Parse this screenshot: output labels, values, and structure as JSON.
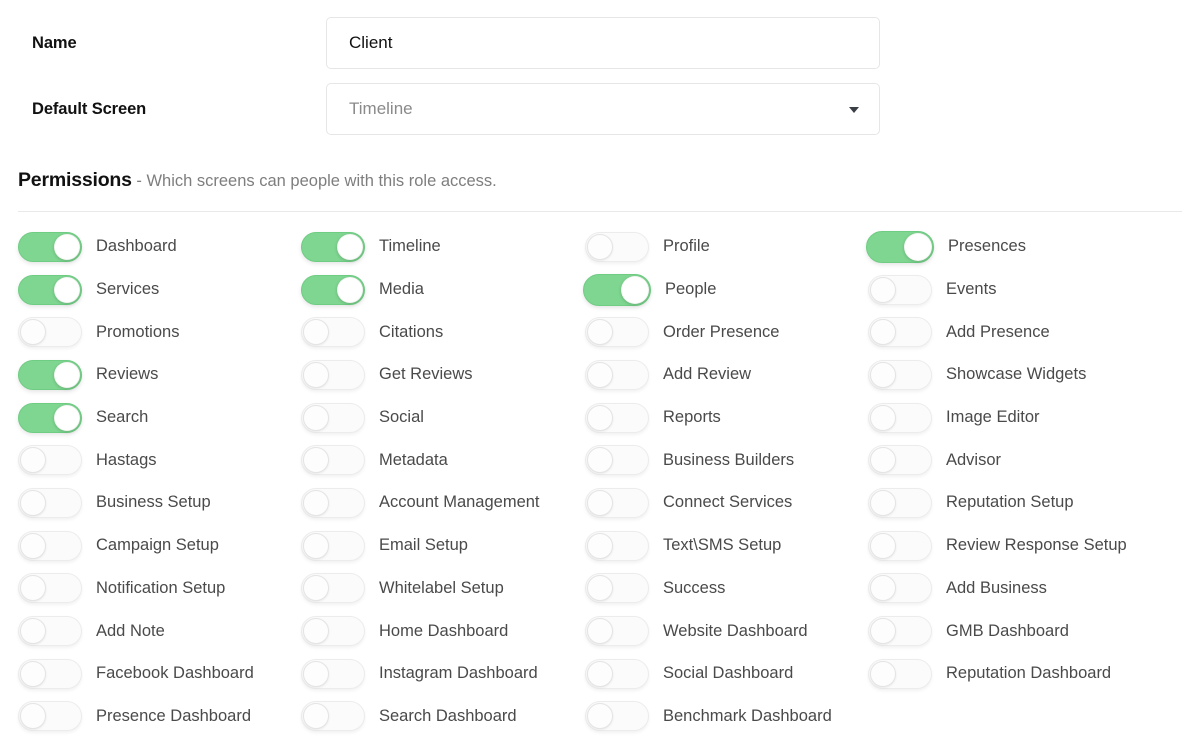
{
  "form": {
    "name": {
      "label": "Name",
      "value": "Client",
      "placeholder": "Name"
    },
    "default_screen": {
      "label": "Default Screen",
      "value": "Timeline",
      "caret_icon": "chevron-down-icon"
    }
  },
  "permissions": {
    "heading": "Permissions",
    "subheading": " - Which screens can people with this role access.",
    "accent_on_color": "#7ed690",
    "off_track_color": "#fbfbfb",
    "columns": 4,
    "items": [
      {
        "label": "Dashboard",
        "on": true,
        "hovered": false
      },
      {
        "label": "Timeline",
        "on": true,
        "hovered": false
      },
      {
        "label": "Profile",
        "on": false,
        "hovered": false
      },
      {
        "label": "Presences",
        "on": true,
        "hovered": true
      },
      {
        "label": "Services",
        "on": true,
        "hovered": false
      },
      {
        "label": "Media",
        "on": true,
        "hovered": false
      },
      {
        "label": "People",
        "on": true,
        "hovered": true
      },
      {
        "label": "Events",
        "on": false,
        "hovered": false
      },
      {
        "label": "Promotions",
        "on": false,
        "hovered": false
      },
      {
        "label": "Citations",
        "on": false,
        "hovered": false
      },
      {
        "label": "Order Presence",
        "on": false,
        "hovered": false
      },
      {
        "label": "Add Presence",
        "on": false,
        "hovered": false
      },
      {
        "label": "Reviews",
        "on": true,
        "hovered": false
      },
      {
        "label": "Get Reviews",
        "on": false,
        "hovered": false
      },
      {
        "label": "Add Review",
        "on": false,
        "hovered": false
      },
      {
        "label": "Showcase Widgets",
        "on": false,
        "hovered": false
      },
      {
        "label": "Search",
        "on": true,
        "hovered": false
      },
      {
        "label": "Social",
        "on": false,
        "hovered": false
      },
      {
        "label": "Reports",
        "on": false,
        "hovered": false
      },
      {
        "label": "Image Editor",
        "on": false,
        "hovered": false
      },
      {
        "label": "Hastags",
        "on": false,
        "hovered": false
      },
      {
        "label": "Metadata",
        "on": false,
        "hovered": false
      },
      {
        "label": "Business Builders",
        "on": false,
        "hovered": false
      },
      {
        "label": "Advisor",
        "on": false,
        "hovered": false
      },
      {
        "label": "Business Setup",
        "on": false,
        "hovered": false
      },
      {
        "label": "Account Management",
        "on": false,
        "hovered": false
      },
      {
        "label": "Connect Services",
        "on": false,
        "hovered": false
      },
      {
        "label": "Reputation Setup",
        "on": false,
        "hovered": false
      },
      {
        "label": "Campaign Setup",
        "on": false,
        "hovered": false
      },
      {
        "label": "Email Setup",
        "on": false,
        "hovered": false
      },
      {
        "label": "Text\\SMS Setup",
        "on": false,
        "hovered": false
      },
      {
        "label": "Review Response Setup",
        "on": false,
        "hovered": false
      },
      {
        "label": "Notification Setup",
        "on": false,
        "hovered": false
      },
      {
        "label": "Whitelabel Setup",
        "on": false,
        "hovered": false
      },
      {
        "label": "Success",
        "on": false,
        "hovered": false
      },
      {
        "label": "Add Business",
        "on": false,
        "hovered": false
      },
      {
        "label": "Add Note",
        "on": false,
        "hovered": false
      },
      {
        "label": "Home Dashboard",
        "on": false,
        "hovered": false
      },
      {
        "label": "Website Dashboard",
        "on": false,
        "hovered": false
      },
      {
        "label": "GMB Dashboard",
        "on": false,
        "hovered": false
      },
      {
        "label": "Facebook Dashboard",
        "on": false,
        "hovered": false
      },
      {
        "label": "Instagram Dashboard",
        "on": false,
        "hovered": false
      },
      {
        "label": "Social Dashboard",
        "on": false,
        "hovered": false
      },
      {
        "label": "Reputation Dashboard",
        "on": false,
        "hovered": false
      },
      {
        "label": "Presence Dashboard",
        "on": false,
        "hovered": false
      },
      {
        "label": "Search Dashboard",
        "on": false,
        "hovered": false
      },
      {
        "label": "Benchmark Dashboard",
        "on": false,
        "hovered": false
      }
    ]
  }
}
